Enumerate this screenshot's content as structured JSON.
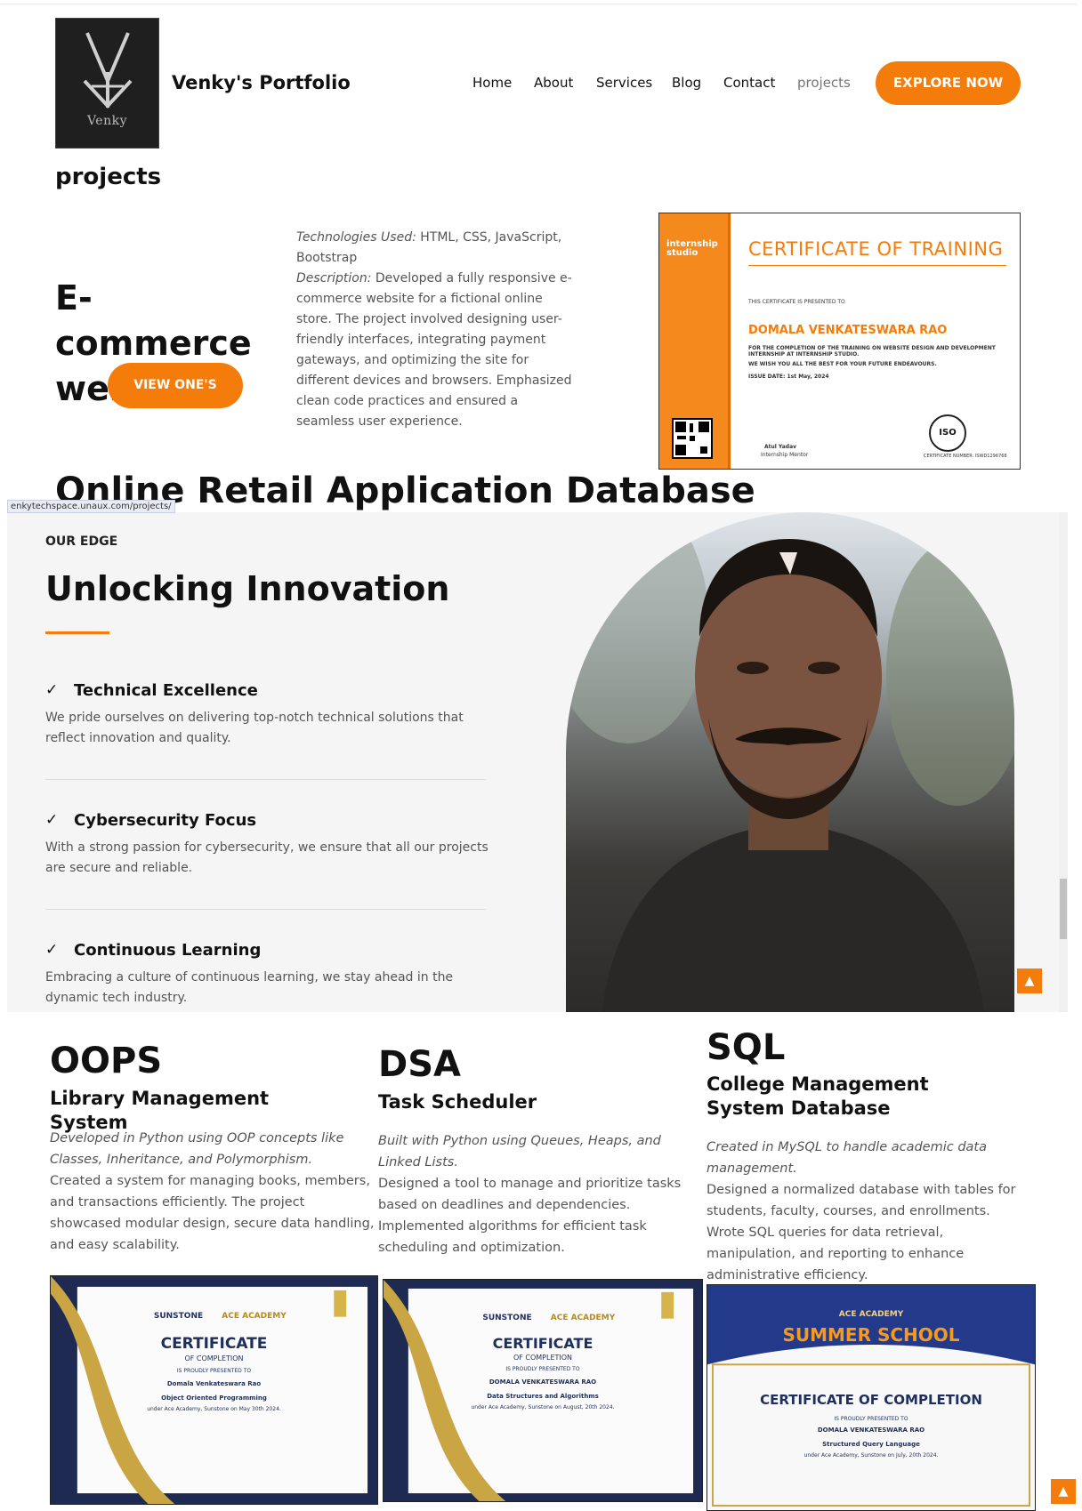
{
  "header": {
    "logo_text": "Venky",
    "site_title": "Venky's Portfolio",
    "nav": [
      "Home",
      "About",
      "Services",
      "Blog",
      "Contact",
      "projects"
    ],
    "explore_label": "EXPLORE NOW"
  },
  "projects_section": {
    "title": "projects",
    "project": {
      "name": "E-commerce website",
      "view_label": "VIEW ONE'S",
      "tech_label": "Technologies Used:",
      "tech_value": "HTML, CSS, JavaScript, Bootstrap",
      "desc_label": "Description:",
      "desc_value": "Developed a fully responsive e-commerce website for a fictional online store. The project involved designing user-friendly interfaces, integrating payment gateways, and optimizing the site for different devices and browsers. Emphasized clean code practices and ensured a seamless user experience."
    },
    "certificate": {
      "brand": "internship studio",
      "heading": "CERTIFICATE OF TRAINING",
      "presented": "THIS CERTIFICATE IS PRESENTED TO",
      "name": "DOMALA VENKATESWARA RAO",
      "line1": "FOR THE COMPLETION OF THE TRAINING ON WEBSITE DESIGN AND DEVELOPMENT INTERNSHIP AT INTERNSHIP STUDIO.",
      "line2": "WE WISH YOU ALL THE BEST FOR YOUR FUTURE ENDEAVOURS.",
      "issue": "ISSUE DATE: 1st May, 2024",
      "signer": "Atul Yadav",
      "signer_role": "Internship Mentor",
      "iso": "ISO",
      "cert_number": "CERTIFICATE NUMBER: ISWD1296768"
    },
    "next_project_title": "Online Retail Application Database"
  },
  "status_url": "enkytechspace.unaux.com/projects/",
  "edge": {
    "label": "OUR EDGE",
    "heading": "Unlocking Innovation",
    "features": [
      {
        "title": "Technical Excellence",
        "desc": "We pride ourselves on delivering top-notch technical solutions that reflect innovation and quality."
      },
      {
        "title": "Cybersecurity Focus",
        "desc": "With a strong passion for cybersecurity, we ensure that all our projects are secure and reliable."
      },
      {
        "title": "Continuous Learning",
        "desc": "Embracing a culture of continuous learning, we stay ahead in the dynamic tech industry."
      }
    ]
  },
  "courses": [
    {
      "title": "OOPS",
      "sub": "Library Management System",
      "italic": "Developed in Python using OOP concepts like Classes, Inheritance, and Polymorphism.",
      "desc": "Created a system for managing books, members, and transactions efficiently. The project showcased modular design, secure data handling, and easy scalability.",
      "cert": {
        "brand1": "SUNSTONE",
        "brand2": "ACE ACADEMY",
        "heading": "CERTIFICATE",
        "sub": "OF COMPLETION",
        "presented": "IS PROUDLY PRESENTED TO",
        "name": "Domala Venkateswara Rao",
        "course": "Object Oriented Programming",
        "line": "under Ace Academy, Sunstone on May 30th 2024."
      }
    },
    {
      "title": "DSA",
      "sub": "Task Scheduler",
      "italic": "Built with Python using Queues, Heaps, and Linked Lists.",
      "desc": "Designed a tool to manage and prioritize tasks based on deadlines and dependencies. Implemented algorithms for efficient task scheduling and optimization.",
      "cert": {
        "brand1": "SUNSTONE",
        "brand2": "ACE ACADEMY",
        "heading": "CERTIFICATE",
        "sub": "OF COMPLETION",
        "presented": "IS PROUDLY PRESENTED TO",
        "name": "DOMALA VENKATESWARA RAO",
        "course": "Data Structures and Algorithms",
        "line": "under Ace Academy, Sunstone on August, 20th 2024."
      }
    },
    {
      "title": "SQL",
      "sub": "College Management System Database",
      "italic": "Created in MySQL to handle academic data management.",
      "desc": "Designed a normalized database with tables for students, faculty, courses, and enrollments. Wrote SQL queries for data retrieval, manipulation, and reporting to enhance administrative efficiency.",
      "cert": {
        "brand2": "ACE ACADEMY",
        "summer": "SUMMER SCHOOL",
        "heading": "CERTIFICATE OF COMPLETION",
        "presented": "IS PROUDLY PRESENTED TO",
        "name": "DOMALA VENKATESWARA RAO",
        "course": "Structured Query Language",
        "line": "under Ace Academy, Sunstone on July, 20th 2024."
      }
    }
  ],
  "icons": {
    "check": "check-icon",
    "to_top": "chevron-up-icon"
  },
  "colors": {
    "accent": "#f47c0b",
    "navy": "#1f2f5c"
  }
}
